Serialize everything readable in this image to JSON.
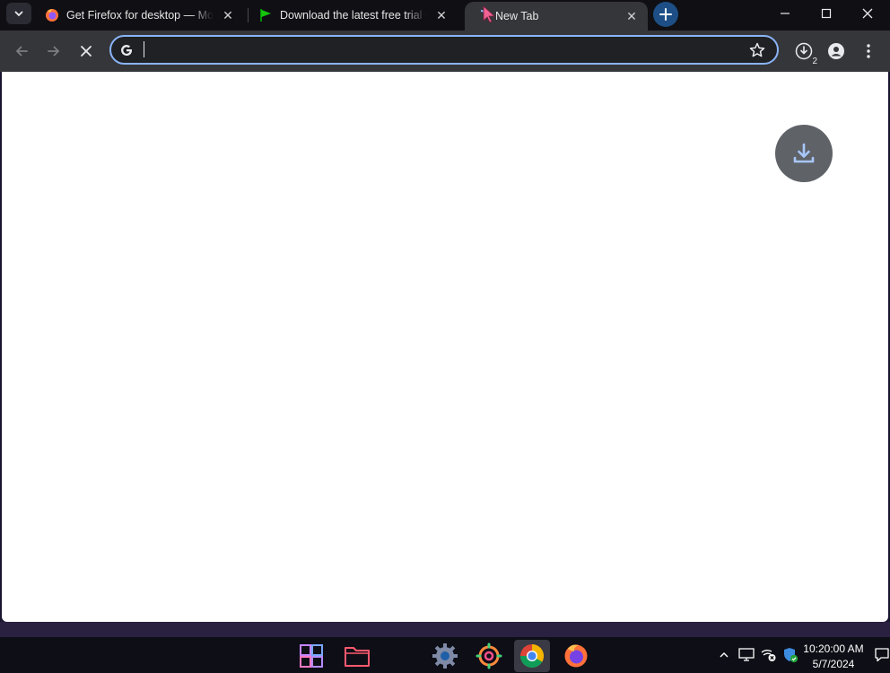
{
  "tabs": [
    {
      "title": "Get Firefox for desktop — Mozilla",
      "icon": "firefox-icon",
      "active": false
    },
    {
      "title": "Download the latest free trial version",
      "icon": "green-flag-icon",
      "active": false
    },
    {
      "title": "New Tab",
      "icon": "loading-spinner-icon",
      "active": true
    }
  ],
  "toolbar": {
    "back_icon": "arrow-back-icon",
    "forward_icon": "arrow-forward-icon",
    "stop_icon": "close-icon",
    "omnibox_value": "",
    "omnibox_search_engine_icon": "google-g-icon",
    "bookmark_icon": "star-icon",
    "downloads_count": "2",
    "profile_icon": "person-icon",
    "menu_icon": "kebab-menu-icon"
  },
  "page": {
    "download_bubble_icon": "download-icon"
  },
  "taskbar": {
    "apps": [
      "start-icon",
      "file-explorer-icon",
      "settings-icon",
      "settings-colorful-icon",
      "chrome-icon",
      "firefox-icon"
    ],
    "active_app": "chrome-icon",
    "time": "10:20:00 AM",
    "date": "5/7/2024"
  },
  "colors": {
    "accent": "#8ab4f8",
    "chrome_bg": "#35363a",
    "tabstrip_bg": "#0f0f14",
    "taskbar_bg": "#0e0e16"
  }
}
